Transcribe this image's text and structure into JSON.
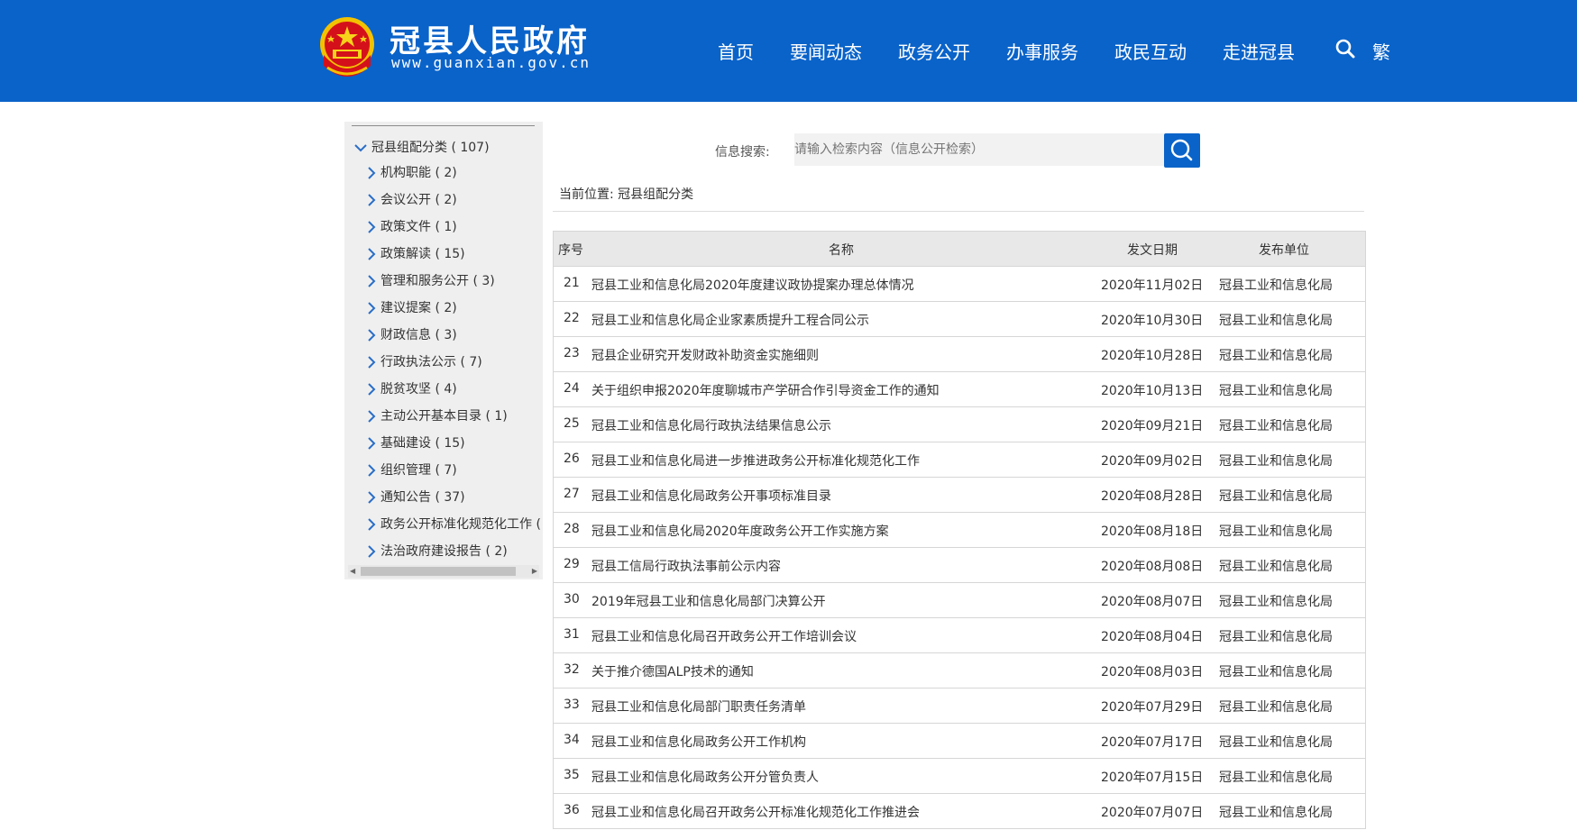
{
  "header": {
    "title": "冠县人民政府",
    "url": "www.guanxian.gov.cn",
    "nav": [
      "首页",
      "要闻动态",
      "政务公开",
      "办事服务",
      "政民互动",
      "走进冠县"
    ],
    "traditional_label": "繁",
    "search_icon": "search-icon",
    "brand_color": "#0a63c9"
  },
  "sidebar": {
    "root": "冠县组配分类 ( 107)",
    "items": [
      "机构职能 ( 2)",
      "会议公开 ( 2)",
      "政策文件 ( 1)",
      "政策解读 ( 15)",
      "管理和服务公开 ( 3)",
      "建议提案 ( 2)",
      "财政信息 ( 3)",
      "行政执法公示 ( 7)",
      "脱贫攻坚 ( 4)",
      "主动公开基本目录 ( 1)",
      "基础建设 ( 15)",
      "组织管理 ( 7)",
      "通知公告 ( 37)",
      "政务公开标准化规范化工作 (",
      "法治政府建设报告 ( 2)"
    ]
  },
  "search": {
    "label": "信息搜索:",
    "placeholder": "请输入检索内容（信息公开检索）"
  },
  "breadcrumb": "当前位置: 冠县组配分类",
  "table": {
    "headers": [
      "序号",
      "名称",
      "发文日期",
      "发布单位"
    ],
    "rows": [
      [
        "21",
        "冠县工业和信息化局2020年度建议政协提案办理总体情况",
        "2020年11月02日",
        "冠县工业和信息化局"
      ],
      [
        "22",
        "冠县工业和信息化局企业家素质提升工程合同公示",
        "2020年10月30日",
        "冠县工业和信息化局"
      ],
      [
        "23",
        "冠县企业研究开发财政补助资金实施细则",
        "2020年10月28日",
        "冠县工业和信息化局"
      ],
      [
        "24",
        "关于组织申报2020年度聊城市产学研合作引导资金工作的通知",
        "2020年10月13日",
        "冠县工业和信息化局"
      ],
      [
        "25",
        "冠县工业和信息化局行政执法结果信息公示",
        "2020年09月21日",
        "冠县工业和信息化局"
      ],
      [
        "26",
        "冠县工业和信息化局进一步推进政务公开标准化规范化工作",
        "2020年09月02日",
        "冠县工业和信息化局"
      ],
      [
        "27",
        "冠县工业和信息化局政务公开事项标准目录",
        "2020年08月28日",
        "冠县工业和信息化局"
      ],
      [
        "28",
        "冠县工业和信息化局2020年度政务公开工作实施方案",
        "2020年08月18日",
        "冠县工业和信息化局"
      ],
      [
        "29",
        "冠县工信局行政执法事前公示内容",
        "2020年08月08日",
        "冠县工业和信息化局"
      ],
      [
        "30",
        "2019年冠县工业和信息化局部门决算公开",
        "2020年08月07日",
        "冠县工业和信息化局"
      ],
      [
        "31",
        "冠县工业和信息化局召开政务公开工作培训会议",
        "2020年08月04日",
        "冠县工业和信息化局"
      ],
      [
        "32",
        "关于推介德国ALP技术的通知",
        "2020年08月03日",
        "冠县工业和信息化局"
      ],
      [
        "33",
        "冠县工业和信息化局部门职责任务清单",
        "2020年07月29日",
        "冠县工业和信息化局"
      ],
      [
        "34",
        "冠县工业和信息化局政务公开工作机构",
        "2020年07月17日",
        "冠县工业和信息化局"
      ],
      [
        "35",
        "冠县工业和信息化局政务公开分管负责人",
        "2020年07月15日",
        "冠县工业和信息化局"
      ],
      [
        "36",
        "冠县工业和信息化局召开政务公开标准化规范化工作推进会",
        "2020年07月07日",
        "冠县工业和信息化局"
      ]
    ]
  }
}
